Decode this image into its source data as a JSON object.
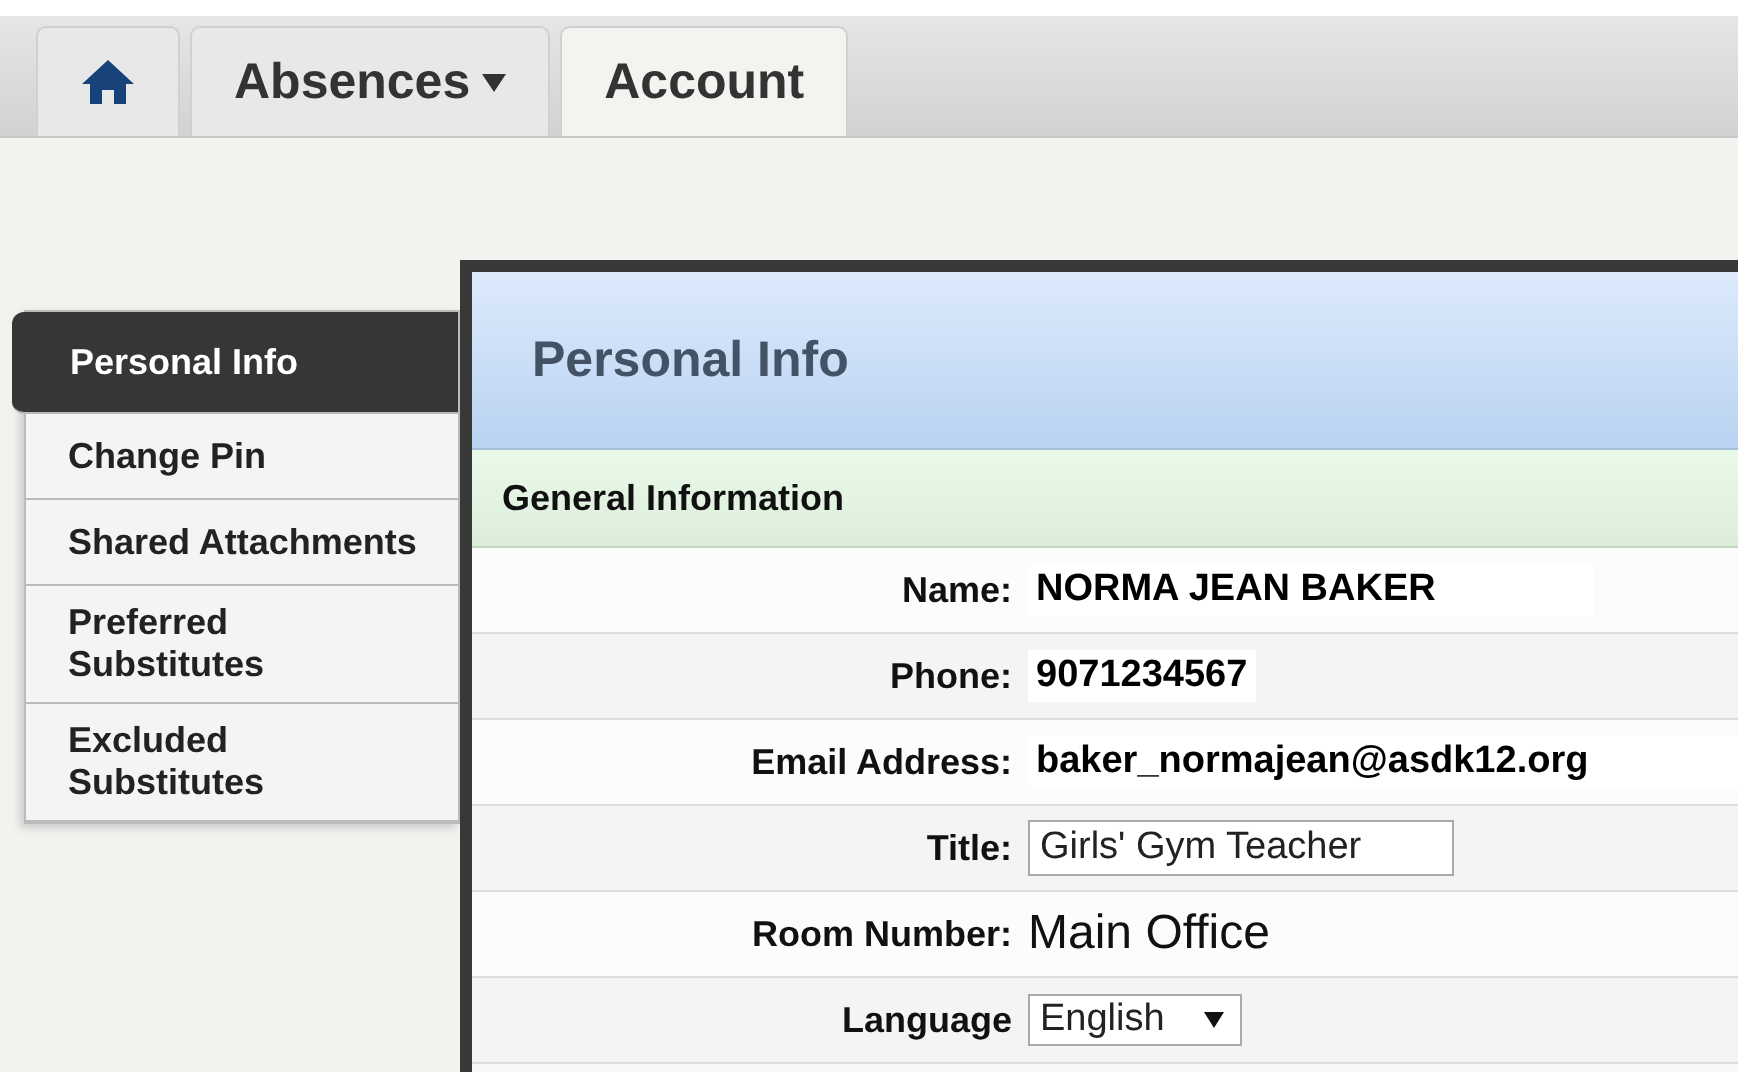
{
  "tabs": [
    {
      "kind": "home",
      "selected": false
    },
    {
      "kind": "menu",
      "label": "Absences",
      "selected": false
    },
    {
      "kind": "plain",
      "label": "Account",
      "selected": true
    }
  ],
  "sidebar": {
    "items": [
      {
        "label": "Personal Info",
        "selected": true
      },
      {
        "label": "Change Pin",
        "selected": false
      },
      {
        "label": "Shared Attachments",
        "selected": false
      },
      {
        "label": "Preferred Substitutes",
        "selected": false
      },
      {
        "label": "Excluded Substitutes",
        "selected": false
      }
    ]
  },
  "panel": {
    "title": "Personal Info",
    "section": "General Information",
    "fields": [
      {
        "kind": "text",
        "label": "Name:",
        "value": "NORMA JEAN BAKER"
      },
      {
        "kind": "text",
        "label": "Phone:",
        "value": "9071234567"
      },
      {
        "kind": "text",
        "label": "Email Address:",
        "value": "baker_normajean@asdk12.org"
      },
      {
        "kind": "input",
        "label": "Title:",
        "value": "Girls' Gym Teacher"
      },
      {
        "kind": "plain",
        "label": "Room Number:",
        "value": "Main Office"
      },
      {
        "kind": "select",
        "label": "Language",
        "value": "English"
      }
    ]
  }
}
